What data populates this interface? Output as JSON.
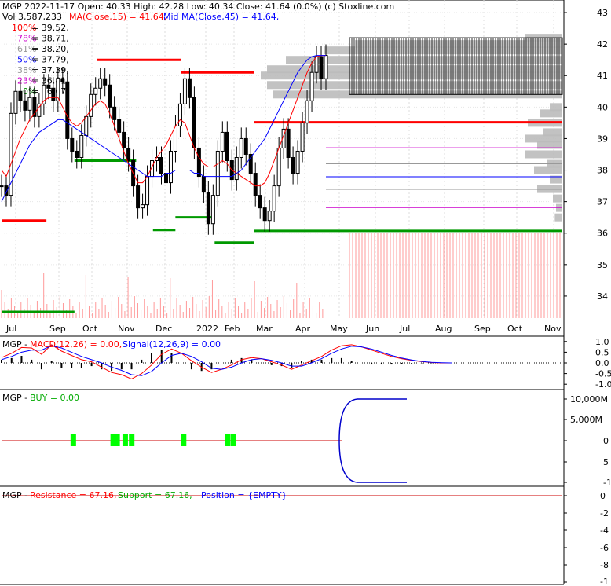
{
  "header": {
    "line1": "MGP  2022-11-17 Open: 40.33  High: 42.28  Low: 40.34  Close: 41.64 (0.0%)  (c) Stoxline.com",
    "vol_label": "Vol 3,587,233",
    "ma_fast": "MA(Close,15) = 41.64,",
    "ma_mid": "Mid MA(Close,45) = 41.64,"
  },
  "fib_levels": [
    {
      "pct": "100%",
      "value": "= 39.52,",
      "price": 39.52,
      "color": "#ff0000"
    },
    {
      "pct": "78%",
      "value": "= 38.71,",
      "price": 38.71,
      "color": "#cc00cc"
    },
    {
      "pct": "61%",
      "value": "= 38.20,",
      "price": 38.2,
      "color": "#999999"
    },
    {
      "pct": "50%",
      "value": "= 37.79,",
      "price": 37.79,
      "color": "#0000ff"
    },
    {
      "pct": "38%",
      "value": "= 37.39,",
      "price": 37.39,
      "color": "#999999"
    },
    {
      "pct": "23%",
      "value": "= 36.81,",
      "price": 36.81,
      "color": "#cc00cc"
    },
    {
      "pct": "0%",
      "value": "= 36.07",
      "price": 36.07,
      "color": "#008800"
    }
  ],
  "colors": {
    "ma15": "#ff0000",
    "ma45": "#0000ff",
    "resistance": "#ff0000",
    "support": "#009900",
    "volume": "#ff9999",
    "profile": "#bbbbbb",
    "buy": "#00ff00"
  },
  "chart_data": [
    {
      "type": "line",
      "panel": "price",
      "title": "MGP  2022-11-17",
      "ylim": [
        33.3,
        43.4
      ],
      "y_ticks": [
        "43",
        "42",
        "41",
        "40",
        "39",
        "38",
        "37",
        "36",
        "35",
        "34"
      ],
      "x_ticks": [
        "Jul",
        "Sep",
        "Oct",
        "Nov",
        "Dec",
        "2022",
        "Feb",
        "Mar",
        "Apr",
        "May",
        "Jun",
        "Jul",
        "Aug",
        "Sep",
        "Oct",
        "Nov"
      ],
      "ohlc_latest": {
        "open": 40.33,
        "high": 42.28,
        "low": 40.34,
        "close": 41.64,
        "change": "0.0%"
      },
      "close_series": [
        37.5,
        37.2,
        39.8,
        40.5,
        40.2,
        39.9,
        40.3,
        39.7,
        40.1,
        40.7,
        40.6,
        40.2,
        40.9,
        40.8,
        39.0,
        38.6,
        38.4,
        39.1,
        39.7,
        40.4,
        40.6,
        40.9,
        40.7,
        40.0,
        39.6,
        39.2,
        38.7,
        38.3,
        37.5,
        36.8,
        36.9,
        37.8,
        38.3,
        38.4,
        37.9,
        37.6,
        38.6,
        39.4,
        40.1,
        40.9,
        40.3,
        38.7,
        37.8,
        37.3,
        36.3,
        37.2,
        38.6,
        39.2,
        38.3,
        37.7,
        38.4,
        39.0,
        38.5,
        37.9,
        37.2,
        36.8,
        36.4,
        36.7,
        37.5,
        38.7,
        39.3,
        38.4,
        37.9,
        38.6,
        39.5,
        40.2,
        41.1,
        41.6,
        40.9,
        41.64
      ],
      "ma15_series": [
        38.0,
        37.8,
        38.2,
        38.6,
        39.0,
        39.3,
        39.6,
        39.8,
        40.0,
        40.2,
        40.3,
        40.3,
        40.3,
        40.0,
        39.7,
        39.5,
        39.4,
        39.5,
        39.7,
        39.9,
        40.1,
        40.2,
        40.1,
        39.8,
        39.4,
        39.0,
        38.6,
        38.2,
        37.9,
        37.6,
        37.6,
        37.8,
        38.1,
        38.4,
        38.6,
        38.8,
        39.1,
        39.4,
        39.6,
        39.5,
        39.1,
        38.7,
        38.4,
        38.2,
        38.1,
        38.1,
        38.2,
        38.3,
        38.2,
        38.0,
        37.9,
        37.8,
        37.7,
        37.6,
        37.5,
        37.5,
        37.6,
        37.9,
        38.3,
        38.7,
        39.1,
        39.5,
        39.9,
        40.3,
        40.7,
        41.1,
        41.4,
        41.6,
        41.64,
        41.64
      ],
      "ma45_series": [
        37.0,
        37.3,
        37.6,
        37.9,
        38.2,
        38.5,
        38.8,
        39.0,
        39.2,
        39.3,
        39.4,
        39.5,
        39.6,
        39.6,
        39.5,
        39.4,
        39.3,
        39.2,
        39.1,
        39.0,
        38.9,
        38.8,
        38.7,
        38.6,
        38.5,
        38.4,
        38.3,
        38.2,
        38.1,
        38.0,
        37.9,
        37.8,
        37.8,
        37.8,
        37.8,
        37.9,
        37.9,
        38.0,
        38.0,
        38.0,
        38.0,
        37.9,
        37.9,
        37.8,
        37.8,
        37.8,
        37.8,
        37.8,
        37.8,
        37.8,
        37.9,
        38.0,
        38.2,
        38.4,
        38.6,
        38.8,
        39.0,
        39.3,
        39.6,
        39.9,
        40.2,
        40.5,
        40.8,
        41.1,
        41.3,
        41.5,
        41.6,
        41.64,
        41.64,
        41.64
      ],
      "resistance_segments": [
        {
          "from_idx": 0,
          "to_idx": 8,
          "price": 36.4
        },
        {
          "from_idx": 17,
          "to_idx": 32,
          "price": 41.5
        },
        {
          "from_idx": 32,
          "to_idx": 45,
          "price": 41.1
        },
        {
          "from_idx": 45,
          "to_idx": 100,
          "price": 39.52
        }
      ],
      "support_segments": [
        {
          "from_idx": 0,
          "to_idx": 13,
          "price": 33.5
        },
        {
          "from_idx": 13,
          "to_idx": 24,
          "price": 38.3
        },
        {
          "from_idx": 27,
          "to_idx": 31,
          "price": 36.1
        },
        {
          "from_idx": 31,
          "to_idx": 38,
          "price": 36.5
        },
        {
          "from_idx": 38,
          "to_idx": 45,
          "price": 35.7
        },
        {
          "from_idx": 45,
          "to_idx": 100,
          "price": 36.07
        }
      ]
    },
    {
      "type": "line",
      "panel": "macd",
      "title": "MGP - MACD(12,26) = 0.00, Signal(12,26,9) = 0.00",
      "ylim": [
        -1.25,
        1.25
      ],
      "y_ticks": [
        "1.0",
        "0.5",
        "0.0",
        "-0.5",
        "-1.0"
      ],
      "macd_series": [
        0.25,
        0.45,
        0.72,
        0.7,
        0.4,
        0.85,
        0.55,
        0.35,
        0.15,
        0.05,
        -0.2,
        -0.45,
        -0.55,
        -0.75,
        -0.5,
        -0.1,
        0.4,
        0.65,
        0.45,
        0.1,
        -0.2,
        -0.45,
        -0.3,
        -0.1,
        0.15,
        0.25,
        0.2,
        0.05,
        -0.1,
        -0.3,
        -0.1,
        0.1,
        0.3,
        0.6,
        0.8,
        0.85,
        0.75,
        0.6,
        0.45,
        0.3,
        0.2,
        0.12,
        0.06,
        0.02,
        0.0,
        0.0
      ],
      "signal_series": [
        0.15,
        0.3,
        0.5,
        0.6,
        0.6,
        0.8,
        0.7,
        0.5,
        0.3,
        0.15,
        0.0,
        -0.2,
        -0.35,
        -0.55,
        -0.6,
        -0.4,
        0.0,
        0.35,
        0.45,
        0.3,
        0.05,
        -0.25,
        -0.3,
        -0.2,
        0.0,
        0.15,
        0.2,
        0.12,
        0.0,
        -0.15,
        -0.15,
        0.0,
        0.2,
        0.45,
        0.65,
        0.78,
        0.75,
        0.65,
        0.5,
        0.35,
        0.23,
        0.14,
        0.07,
        0.03,
        0.01,
        0.0
      ]
    },
    {
      "type": "line",
      "panel": "buy",
      "title": "MGP - BUY = 0.00",
      "y_ticks": [
        "10,000M",
        "5,000M",
        "0",
        "5",
        "-1"
      ],
      "buy_signal_x_fraction": [
        0.22,
        0.343,
        0.355,
        0.38,
        0.4,
        0.56,
        0.695,
        0.713
      ]
    },
    {
      "type": "line",
      "panel": "position",
      "title": "MGP - Resistance = 67.16, Support = 67.16, Position = {EMPTY}",
      "y_ticks": [
        "0",
        "-2",
        "-4",
        "-6",
        "-8",
        "-1"
      ]
    }
  ],
  "legends": {
    "macd_prefix": "MGP - ",
    "macd_label": "MACD(12,26) = 0.00,",
    "signal_label": "Signal(12,26,9) = 0.00",
    "buy_prefix": "MGP - ",
    "buy_label": "BUY = 0.00",
    "pos_prefix": "MGP - ",
    "resistance_label": "Resistance = 67.16,",
    "support_label": "Support = 67.16,",
    "position_label": "Position = {EMPTY}"
  }
}
